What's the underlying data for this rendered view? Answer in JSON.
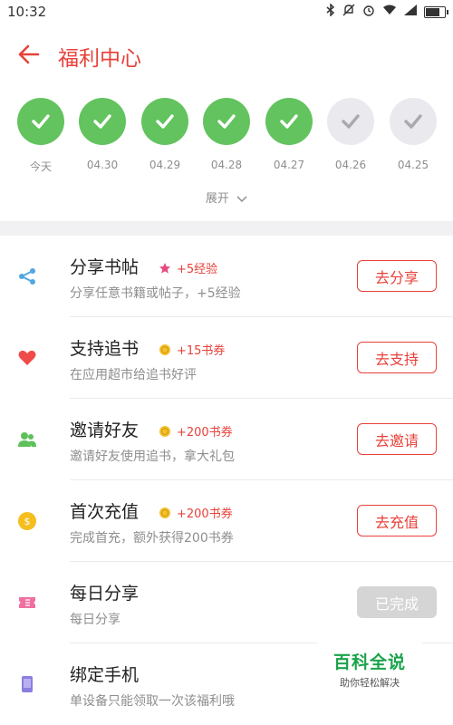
{
  "status_bar": {
    "time": "10:32"
  },
  "header": {
    "title": "福利中心"
  },
  "checkin": {
    "days": [
      {
        "label": "今天",
        "done": true
      },
      {
        "label": "04.30",
        "done": true
      },
      {
        "label": "04.29",
        "done": true
      },
      {
        "label": "04.28",
        "done": true
      },
      {
        "label": "04.27",
        "done": true
      },
      {
        "label": "04.26",
        "done": false
      },
      {
        "label": "04.25",
        "done": false
      }
    ],
    "expand_label": "展开"
  },
  "tasks": [
    {
      "name": "分享书帖",
      "reward": "+5经验",
      "reward_icon": "star-icon",
      "description": "分享任意书籍或帖子，+5经验",
      "button": "去分享",
      "icon": "share-icon",
      "icon_color": "#4fa8e0"
    },
    {
      "name": "支持追书",
      "reward": "+15书券",
      "reward_icon": "coin-icon",
      "description": "在应用超市给追书好评",
      "button": "去支持",
      "icon": "heart-icon",
      "icon_color": "#ef4c49"
    },
    {
      "name": "邀请好友",
      "reward": "+200书券",
      "reward_icon": "coin-icon",
      "description": "邀请好友使用追书，拿大礼包",
      "button": "去邀请",
      "icon": "people-icon",
      "icon_color": "#5cc15a"
    },
    {
      "name": "首次充值",
      "reward": "+200书券",
      "reward_icon": "coin-icon",
      "description": "完成首充，额外获得200书券",
      "button": "去充值",
      "icon": "coin-icon",
      "icon_color": "#f5be1f"
    },
    {
      "name": "每日分享",
      "reward": "",
      "reward_icon": "",
      "description": "每日分享",
      "button": "已完成",
      "icon": "ticket-icon",
      "icon_color": "#f06fa0"
    },
    {
      "name": "绑定手机",
      "reward": "",
      "reward_icon": "",
      "description": "单设备只能领取一次该福利哦",
      "button": "",
      "icon": "phone-icon",
      "icon_color": "#8a7ee0"
    }
  ],
  "watermark": {
    "main": "百科全说",
    "sub": "助你轻松解决"
  }
}
